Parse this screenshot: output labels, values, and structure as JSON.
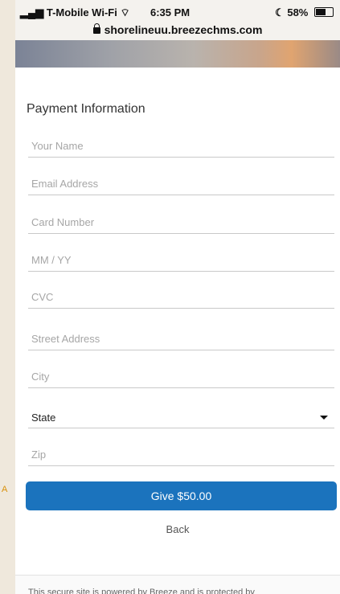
{
  "status_bar": {
    "carrier": "T-Mobile Wi-Fi",
    "time": "6:35 PM",
    "battery": "58%"
  },
  "url_bar": {
    "url": "shorelineuu.breezechms.com"
  },
  "form": {
    "title": "Payment Information",
    "fields": {
      "name_placeholder": "Your Name",
      "email_placeholder": "Email Address",
      "card_placeholder": "Card Number",
      "expiry_placeholder": "MM / YY",
      "cvc_placeholder": "CVC",
      "street_placeholder": "Street Address",
      "city_placeholder": "City",
      "state_label": "State",
      "zip_placeholder": "Zip"
    },
    "give_button": "Give $50.00",
    "back_link": "Back"
  },
  "footer": {
    "text": "This secure site is powered by Breeze and is protected by"
  },
  "edge_mark": "A",
  "colors": {
    "accent": "#1b73bd",
    "background": "#ffffff",
    "page_bg": "#efe8dc"
  }
}
